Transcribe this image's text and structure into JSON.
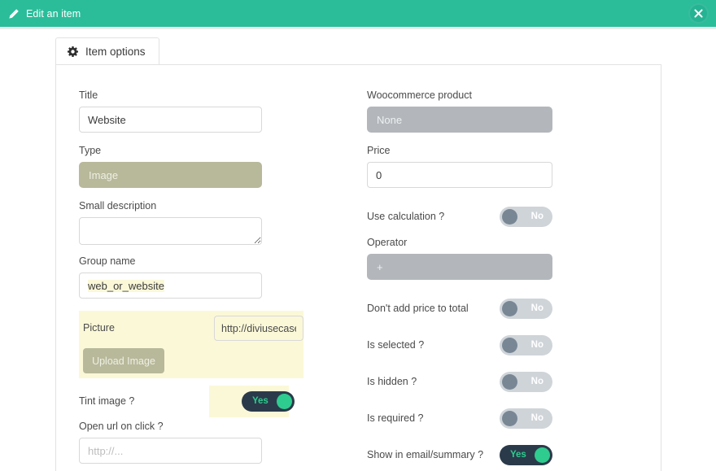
{
  "window": {
    "title": "Edit an item",
    "edit_icon": "pencil-icon",
    "close_icon": "close-icon",
    "accent_color": "#2bbd9a"
  },
  "tab": {
    "label": "Item options",
    "icon": "gear-icon"
  },
  "left_column": {
    "title": {
      "label": "Title",
      "value": "Website"
    },
    "type": {
      "label": "Type",
      "value": "Image"
    },
    "small_description": {
      "label": "Small description",
      "value": "",
      "placeholder": ""
    },
    "group_name": {
      "label": "Group name",
      "value": "web_or_website"
    },
    "picture": {
      "label": "Picture",
      "url_value": "http://diviusecase",
      "upload_label": "Upload Image"
    },
    "tint_image": {
      "label": "Tint image ?",
      "state": "Yes"
    },
    "open_url_on_click": {
      "label": "Open url on click ?",
      "value": "",
      "placeholder": "http://..."
    }
  },
  "right_column": {
    "woocommerce_product": {
      "label": "Woocommerce product",
      "value": "None"
    },
    "price": {
      "label": "Price",
      "value": "0"
    },
    "use_calculation": {
      "label": "Use calculation ?",
      "state": "No"
    },
    "operator": {
      "label": "Operator",
      "value": "+"
    },
    "dont_add_price": {
      "label": "Don't add price to total",
      "state": "No"
    },
    "is_selected": {
      "label": "Is selected ?",
      "state": "No"
    },
    "is_hidden": {
      "label": "Is hidden ?",
      "state": "No"
    },
    "is_required": {
      "label": "Is required ?",
      "state": "No"
    },
    "show_in_email": {
      "label": "Show in email/summary ?",
      "state": "Yes"
    }
  }
}
